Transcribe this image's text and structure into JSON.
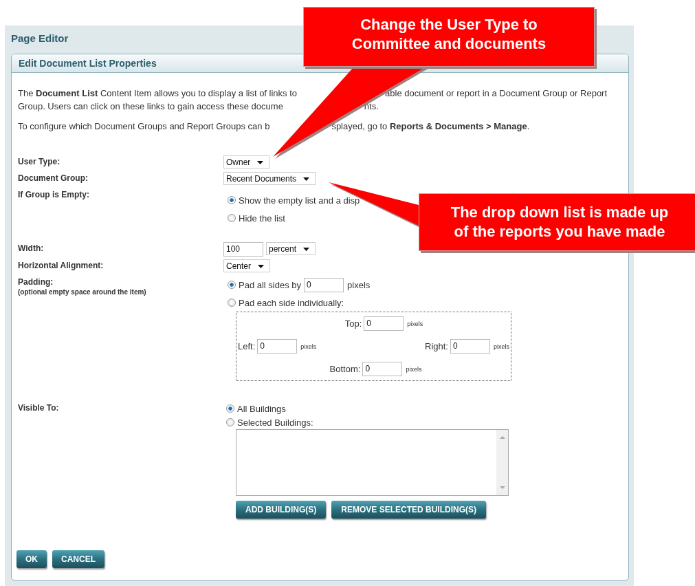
{
  "window": {
    "title": "Page Editor"
  },
  "panel": {
    "title": "Edit Document List Properties"
  },
  "intro": [
    {
      "parts": [
        "The **Document List** Content Item allows you to display a list of links to",
        "able document or report in a Document Group or Report"
      ]
    },
    {
      "parts": [
        "Group. Users can click on these links to gain access these docume",
        "nts."
      ]
    },
    {
      "parts": [
        "To configure which Document Groups and Report Groups can b",
        "splayed, go to **Reports & Documents > Manage**."
      ]
    }
  ],
  "form": [
    {
      "kind": "select",
      "label": "User Type:",
      "value": "Owner"
    },
    {
      "kind": "select",
      "label": "Document Group:",
      "value": "Recent Documents"
    },
    {
      "kind": "radios",
      "label": "If Group is Empty:",
      "options": [
        {
          "label": "Show the empty list and a disp",
          "selected": true
        },
        {
          "label": "Hide the list",
          "selected": false
        }
      ]
    },
    {
      "kind": "size",
      "label": "Width:",
      "value": "100",
      "unit": "percent"
    },
    {
      "kind": "select",
      "label": "Horizontal Alignment:",
      "value": "Center"
    },
    {
      "kind": "padding",
      "label": "Padding:",
      "note": "(optional empty space around the item)",
      "options": [
        {
          "label": "Pad all sides by",
          "value": "0",
          "unit": "pixels",
          "selected": true
        },
        {
          "label": "Pad each side individually:",
          "selected": false
        }
      ],
      "sides": [
        {
          "label": "Top:",
          "value": "0",
          "unit": "pixels"
        },
        {
          "label": "Left:",
          "value": "0",
          "unit": "pixels"
        },
        {
          "label": "Right:",
          "value": "0",
          "unit": "pixels"
        },
        {
          "label": "Bottom:",
          "value": "0",
          "unit": "pixels"
        }
      ]
    },
    {
      "kind": "visibility",
      "label": "Visible To:",
      "options": [
        {
          "label": "All Buildings",
          "selected": true
        },
        {
          "label": "Selected Buildings:",
          "selected": false
        }
      ],
      "buttons": [
        "ADD BUILDING(S)",
        "REMOVE SELECTED BUILDING(S)"
      ]
    }
  ],
  "buttons": [
    "OK",
    "CANCEL"
  ],
  "callouts": [
    {
      "lines": [
        "Change the User Type to",
        "Committee and documents"
      ]
    },
    {
      "lines": [
        "The drop down list is made up",
        "of the reports you have made"
      ]
    }
  ]
}
